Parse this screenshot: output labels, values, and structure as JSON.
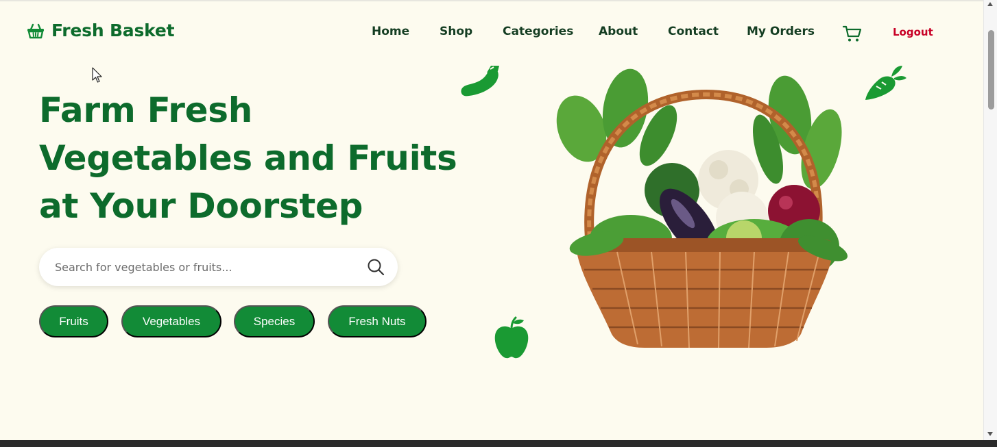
{
  "brand": {
    "name": "Fresh Basket",
    "icon": "basket-icon"
  },
  "nav": {
    "links": [
      {
        "label": "Home"
      },
      {
        "label": "Shop"
      },
      {
        "label": "Categories"
      },
      {
        "label": "About"
      },
      {
        "label": "Contact"
      },
      {
        "label": "My Orders"
      }
    ],
    "cart_icon": "cart-icon",
    "logout_label": "Logout"
  },
  "hero": {
    "headline_lines": [
      "Farm Fresh",
      "Vegetables and Fruits",
      "at Your Doorstep"
    ],
    "search": {
      "placeholder": "Search for vegetables or fruits...",
      "value": "",
      "icon": "search-icon"
    },
    "categories": [
      {
        "label": "Fruits"
      },
      {
        "label": "Vegetables"
      },
      {
        "label": "Species"
      },
      {
        "label": "Fresh Nuts"
      }
    ],
    "decorations": [
      "chili-icon",
      "carrot-icon",
      "apple-icon",
      "vegetable-basket-image"
    ]
  },
  "colors": {
    "background": "#fdfbef",
    "brand_green": "#0d6b2c",
    "chip_green": "#128b37",
    "logout_red": "#c80026",
    "nav_text": "#143d22"
  }
}
